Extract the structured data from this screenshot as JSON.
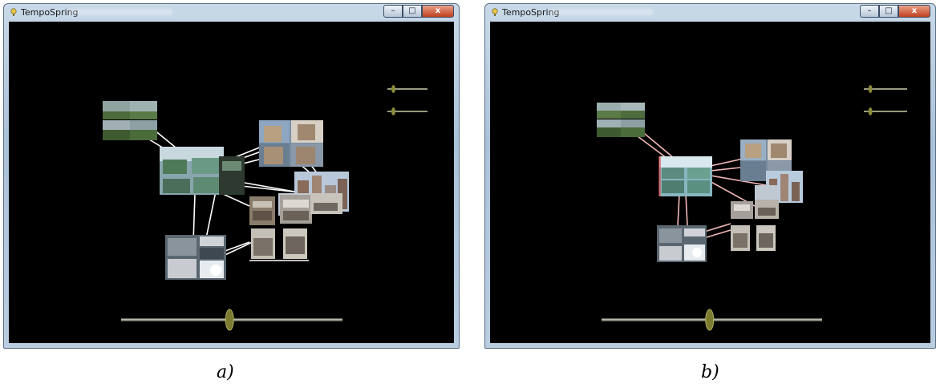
{
  "panels": [
    {
      "id": "a",
      "window_title": "TempoSpring",
      "caption": "a)",
      "controls": {
        "minimize": "–",
        "maximize": "□",
        "close": "x"
      }
    },
    {
      "id": "b",
      "window_title": "TempoSpring",
      "caption": "b)",
      "controls": {
        "minimize": "–",
        "maximize": "□",
        "close": "x"
      }
    }
  ],
  "sliders": {
    "top_slider_1_level": 0.15,
    "top_slider_2_level": 0.15,
    "timeline_level": 0.49
  },
  "colors": {
    "canvas": "#000000",
    "link_white": "#ffffff",
    "link_pink": "#f2b8b8",
    "slider_track": "#9a9a80",
    "slider_thumb": "#8a8a3a"
  }
}
